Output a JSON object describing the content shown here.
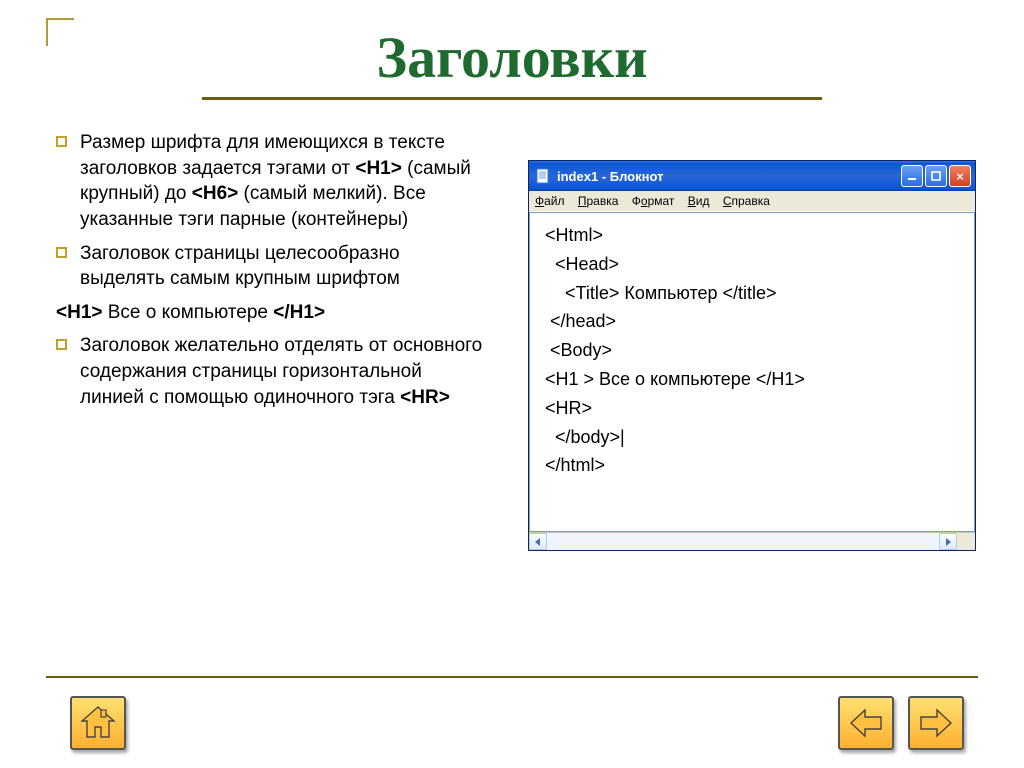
{
  "title": "Заголовки",
  "bullets": [
    "Размер шрифта для имеющихся в тексте заголовков задается тэгами от <H1> (самый крупный) до <H6> (самый мелкий). Все указанные тэги парные (контейнеры)",
    "Заголовок страницы целесообразно выделять самым крупным шрифтом",
    "Заголовок желательно отделять от основного содержания страницы горизонтальной линией с помощью одиночного тэга <HR>"
  ],
  "example_line": "<H1> Все о компьютере </H1>",
  "notepad": {
    "window_title": "index1 - Блокнот",
    "menus": [
      "Файл",
      "Правка",
      "Формат",
      "Вид",
      "Справка"
    ],
    "code_lines": [
      " <Html>",
      "   <Head>",
      "     <Title> Компьютер </title>",
      "  </head>",
      "  <Body>",
      " <H1 > Все о компьютере </H1>",
      " <HR>",
      "   </body>|",
      " </html>"
    ]
  },
  "nav": {
    "home": "home-button",
    "prev": "prev-button",
    "next": "next-button"
  }
}
